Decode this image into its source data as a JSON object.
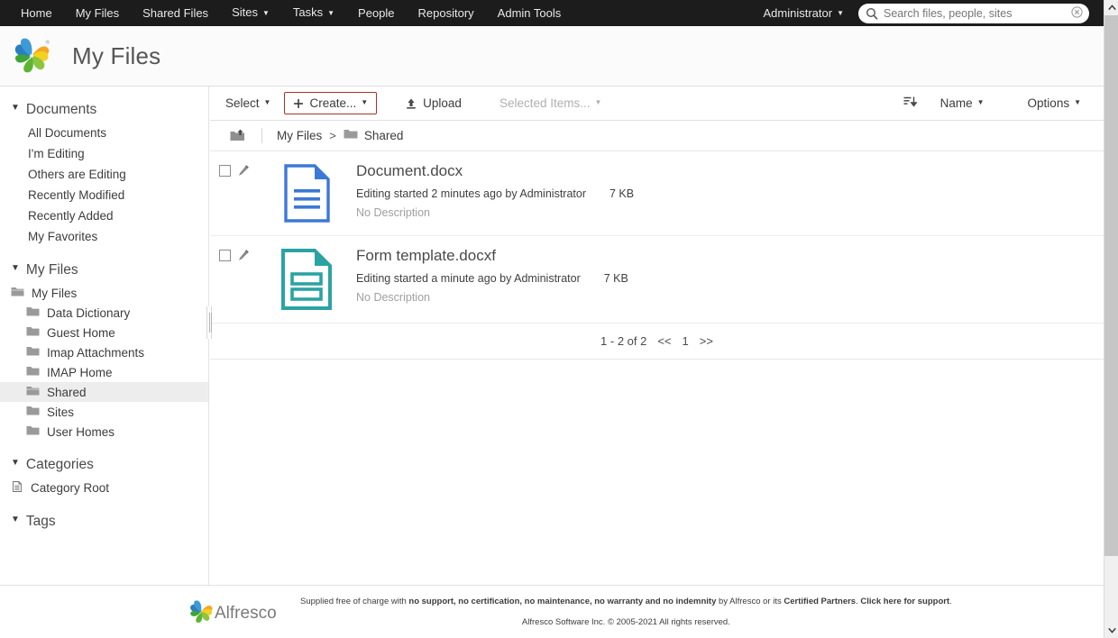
{
  "topnav": {
    "items": [
      {
        "label": "Home",
        "has_caret": false
      },
      {
        "label": "My Files",
        "has_caret": false
      },
      {
        "label": "Shared Files",
        "has_caret": false
      },
      {
        "label": "Sites",
        "has_caret": true
      },
      {
        "label": "Tasks",
        "has_caret": true
      },
      {
        "label": "People",
        "has_caret": false
      },
      {
        "label": "Repository",
        "has_caret": false
      },
      {
        "label": "Admin Tools",
        "has_caret": false
      }
    ],
    "user_menu": "Administrator",
    "user_caret": "▾",
    "search": {
      "placeholder": "Search files, people, sites",
      "value": "",
      "icon": "search-icon",
      "clear_icon": "clear-circle-icon"
    },
    "background": "#1c1c1c"
  },
  "header": {
    "title": "My Files",
    "logo": "alfresco-pinwheel-logo"
  },
  "sidebar": {
    "sections": [
      {
        "title": "Documents",
        "triangle": "▼",
        "type": "links",
        "items": [
          {
            "label": "All Documents"
          },
          {
            "label": "I'm Editing"
          },
          {
            "label": "Others are Editing"
          },
          {
            "label": "Recently Modified"
          },
          {
            "label": "Recently Added"
          },
          {
            "label": "My Favorites"
          }
        ]
      },
      {
        "title": "My Files",
        "triangle": "▼",
        "type": "tree",
        "items": [
          {
            "label": "My Files",
            "icon": "folder-open-icon",
            "indented": false,
            "selected": false
          },
          {
            "label": "Data Dictionary",
            "icon": "folder-icon",
            "indented": true,
            "selected": false
          },
          {
            "label": "Guest Home",
            "icon": "folder-icon",
            "indented": true,
            "selected": false
          },
          {
            "label": "Imap Attachments",
            "icon": "folder-icon",
            "indented": true,
            "selected": false
          },
          {
            "label": "IMAP Home",
            "icon": "folder-icon",
            "indented": true,
            "selected": false
          },
          {
            "label": "Shared",
            "icon": "folder-open-icon",
            "indented": true,
            "selected": true
          },
          {
            "label": "Sites",
            "icon": "folder-icon",
            "indented": true,
            "selected": false
          },
          {
            "label": "User Homes",
            "icon": "folder-icon",
            "indented": true,
            "selected": false
          }
        ]
      },
      {
        "title": "Categories",
        "triangle": "▼",
        "type": "tree",
        "items": [
          {
            "label": "Category Root",
            "icon": "category-list-icon",
            "indented": false,
            "selected": false
          }
        ]
      },
      {
        "title": "Tags",
        "triangle": "▼",
        "type": "tree",
        "items": []
      }
    ]
  },
  "toolbar": {
    "select_label": "Select",
    "select_caret": "▾",
    "create_label": "Create...",
    "create_caret": "▾",
    "create_plus": "+",
    "create_highlight_color": "#a93226",
    "upload_label": "Upload",
    "upload_icon": "upload-icon",
    "selected_items_label": "Selected Items...",
    "selected_items_caret": "▾",
    "sort_icon": "sort-descending-icon",
    "sort_label": "Name",
    "sort_caret": "▾",
    "options_label": "Options",
    "options_caret": "▾"
  },
  "breadcrumb": {
    "up_icon": "folder-up-icon",
    "root": "My Files",
    "separator": ">",
    "current": "Shared",
    "current_icon": "folder-icon"
  },
  "files": [
    {
      "name": "Document.docx",
      "icon": "docx-file-icon",
      "icon_color": "#3b78d8",
      "status": "Editing started 2 minutes ago by Administrator",
      "size": "7 KB",
      "description": "No Description",
      "checked": false
    },
    {
      "name": "Form template.docxf",
      "icon": "docxf-file-icon",
      "icon_color": "#2ca3a3",
      "status": "Editing started a minute ago by Administrator",
      "size": "7 KB",
      "description": "No Description",
      "checked": false
    }
  ],
  "pagination": {
    "range": "1 - 2 of 2",
    "prev": "<<",
    "current_page": "1",
    "next": ">>"
  },
  "footer": {
    "logo": "alfresco-logo",
    "line1_a": "Supplied free of charge with ",
    "line1_b": "no support, no certification, no maintenance, no warranty and no indemnity",
    "line1_c": " by Alfresco or its ",
    "line1_link1": "Certified Partners",
    "line1_d": ". ",
    "line1_link2": "Click here for support",
    "line1_e": ".",
    "line2": "Alfresco Software Inc. © 2005-2021 All rights reserved."
  },
  "scrollbar": {
    "up_arrow": "chevron-up-icon",
    "down_arrow": "chevron-down-icon"
  }
}
